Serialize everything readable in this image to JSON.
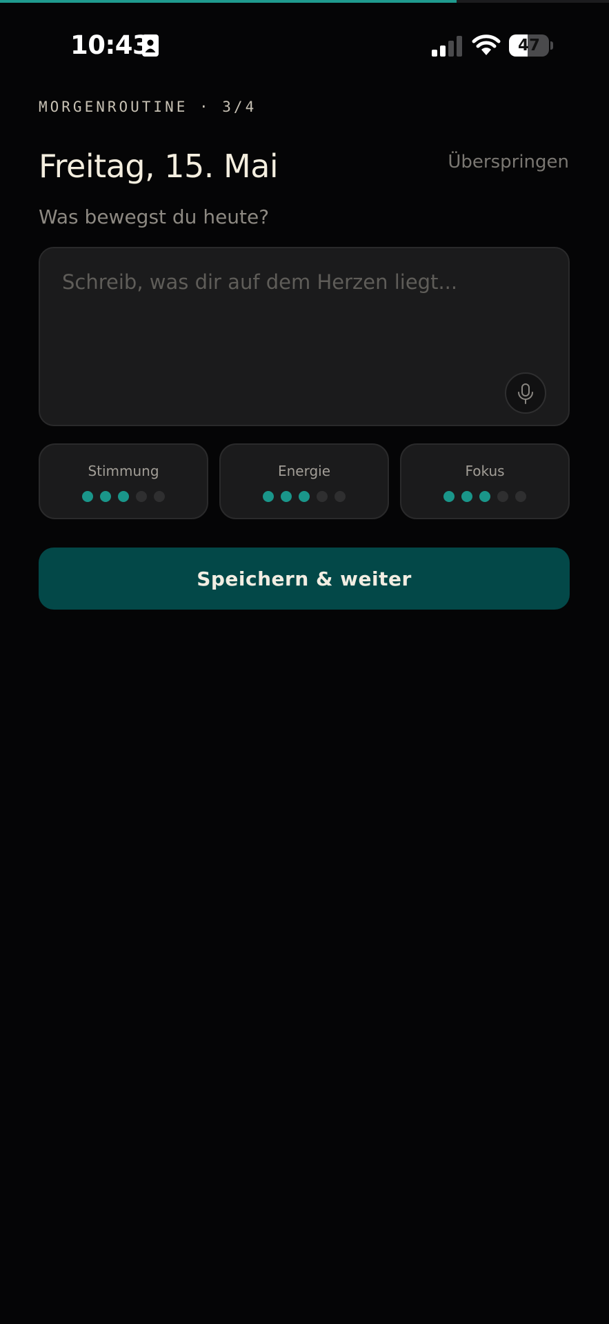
{
  "progress": {
    "fraction": 0.75
  },
  "status_bar": {
    "time": "10:43",
    "battery": "47",
    "battery_level": 0.47
  },
  "header": {
    "routine_label": "MORGENROUTINE · 3/4",
    "title": "Freitag, 15. Mai",
    "skip_label": "Überspringen",
    "prompt": "Was bewegst du heute?"
  },
  "journal": {
    "placeholder": "Schreib, was dir auf dem Herzen liegt...",
    "value": ""
  },
  "metrics": [
    {
      "label": "Stimmung",
      "value": 3,
      "max": 5
    },
    {
      "label": "Energie",
      "value": 3,
      "max": 5
    },
    {
      "label": "Fokus",
      "value": 3,
      "max": 5
    }
  ],
  "actions": {
    "save_label": "Speichern & weiter"
  },
  "colors": {
    "accent": "#1a968a",
    "button": "#034848",
    "background": "#050506",
    "card": "#1b1b1c"
  },
  "icons": {
    "status": [
      "contact-card-icon",
      "cellular-signal-icon",
      "wifi-icon",
      "battery-icon"
    ],
    "mic": "microphone-icon"
  }
}
